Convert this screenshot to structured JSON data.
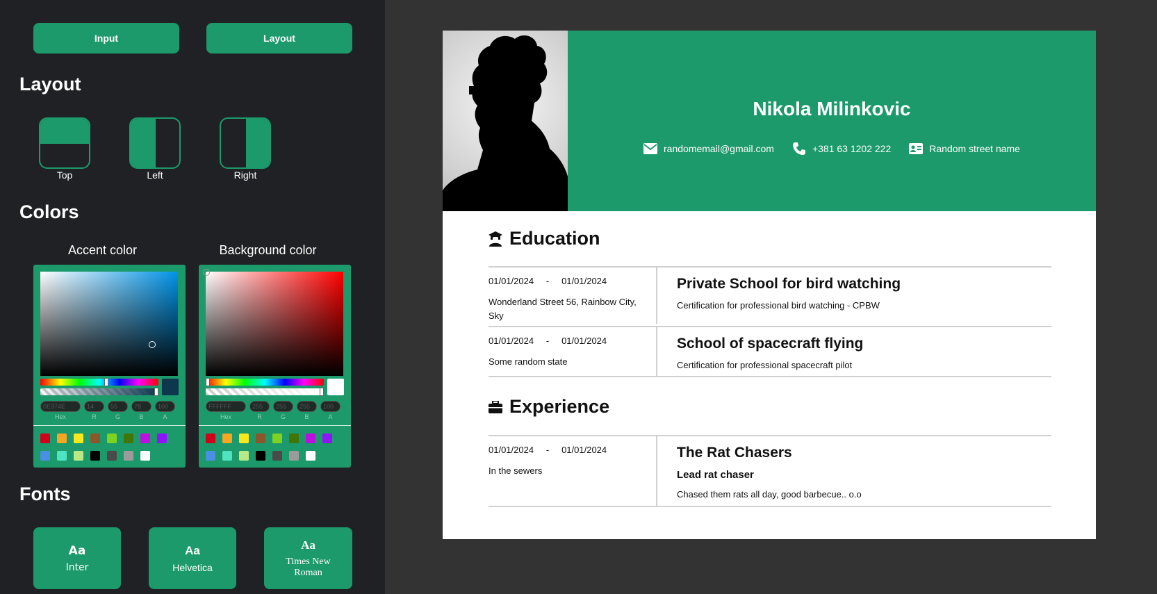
{
  "tabs": {
    "input": "Input",
    "layout": "Layout"
  },
  "layout": {
    "heading": "Layout",
    "options": [
      {
        "label": "Top"
      },
      {
        "label": "Left"
      },
      {
        "label": "Right"
      }
    ]
  },
  "colors": {
    "heading": "Colors",
    "accent": {
      "title": "Accent color",
      "hex": "0E374E",
      "r": "14",
      "g": "55",
      "b": "78",
      "a": "100",
      "swatch": "#0e374e"
    },
    "background": {
      "title": "Background color",
      "hex": "FFFFFF",
      "r": "255",
      "g": "255",
      "b": "255",
      "a": "100",
      "swatch": "#ffffff"
    },
    "field_labels": {
      "hex": "Hex",
      "r": "R",
      "g": "G",
      "b": "B",
      "a": "A"
    },
    "presets_row1": [
      "#d0021b",
      "#f5a623",
      "#f8e71c",
      "#8b572a",
      "#7ed321",
      "#417505",
      "#bd10e0",
      "#9013fe"
    ],
    "presets_row2": [
      "#4a90e2",
      "#50e3c2",
      "#b8e986",
      "#000000",
      "#4a4a4a",
      "#9b9b9b",
      "#ffffff"
    ]
  },
  "fonts": {
    "heading": "Fonts",
    "sample": "Aa",
    "options": [
      {
        "name": "Inter"
      },
      {
        "name": "Helvetica"
      },
      {
        "name": "Times New Roman"
      }
    ]
  },
  "accent_color": "#1c9a6b",
  "resume": {
    "name": "Nikola Milinkovic",
    "email": "randomemail@gmail.com",
    "phone": "+381 63 1202 222",
    "address": "Random street name",
    "date_separator": "-",
    "education": {
      "heading": "Education",
      "items": [
        {
          "start": "01/01/2024",
          "end": "01/01/2024",
          "location": "Wonderland Street 56, Rainbow City, Sky",
          "school": "Private School for bird watching",
          "degree": "Certification for professional bird watching - CPBW"
        },
        {
          "start": "01/01/2024",
          "end": "01/01/2024",
          "location": "Some random state",
          "school": "School of spacecraft flying",
          "degree": "Certification for professional spacecraft pilot"
        }
      ]
    },
    "experience": {
      "heading": "Experience",
      "items": [
        {
          "start": "01/01/2024",
          "end": "01/01/2024",
          "location": "In the sewers",
          "company": "The Rat Chasers",
          "position": "Lead rat chaser",
          "description": "Chased them rats all day, good barbecue.. o.o"
        }
      ]
    }
  }
}
